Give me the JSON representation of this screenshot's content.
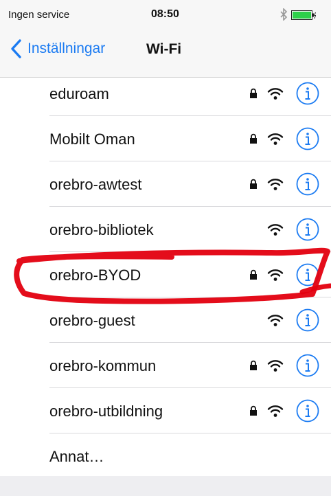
{
  "status_bar": {
    "carrier": "Ingen service",
    "time": "08:50",
    "bluetooth_icon": "bluetooth-icon",
    "battery_icon": "battery-icon",
    "battery_color": "#2ed04a"
  },
  "nav": {
    "back_label": "Inställningar",
    "title": "Wi-Fi",
    "accent_color": "#1b7bf2"
  },
  "networks": [
    {
      "name": "eduroam",
      "secured": true
    },
    {
      "name": "Mobilt Oman",
      "secured": true
    },
    {
      "name": "orebro-awtest",
      "secured": true
    },
    {
      "name": "orebro-bibliotek",
      "secured": false
    },
    {
      "name": "orebro-BYOD",
      "secured": true,
      "highlighted": true
    },
    {
      "name": "orebro-guest",
      "secured": false
    },
    {
      "name": "orebro-kommun",
      "secured": true
    },
    {
      "name": "orebro-utbildning",
      "secured": true
    }
  ],
  "other_label": "Annat…",
  "icons": {
    "lock": "lock-icon",
    "wifi": "wifi-icon",
    "info": "info-icon"
  },
  "highlight_color": "#e3000f"
}
